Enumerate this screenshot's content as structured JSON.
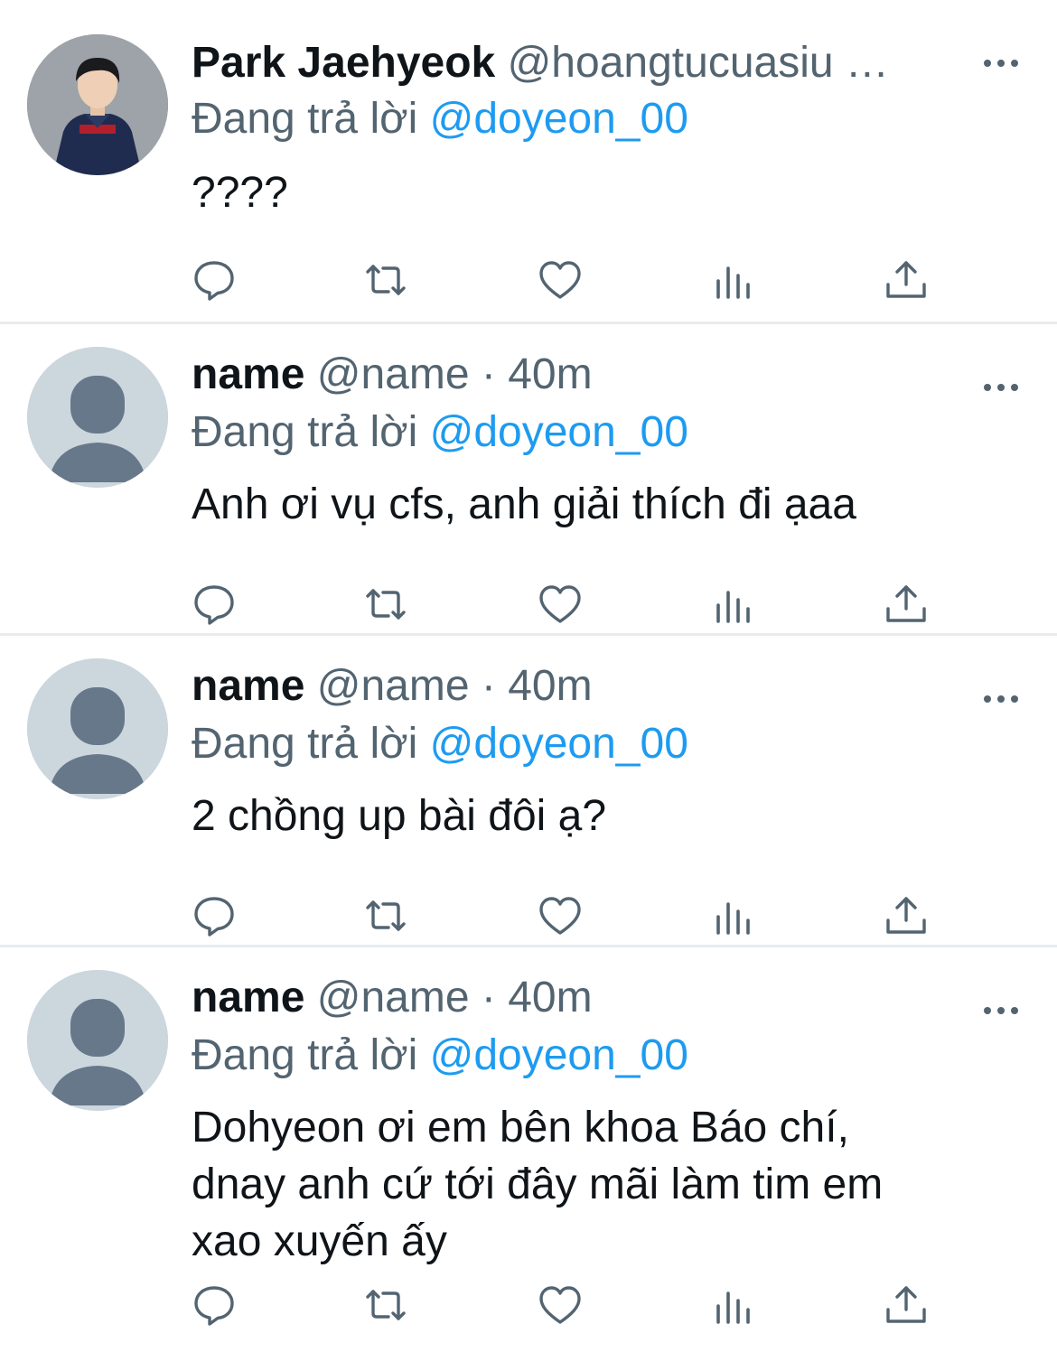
{
  "colors": {
    "text_primary": "#0f1419",
    "text_secondary": "#536471",
    "link_blue": "#1d9bf0",
    "divider": "#e9ecef",
    "default_avatar_bg": "#ccd6dd",
    "default_avatar_fg": "#66788a"
  },
  "reply_prefix": "Đang trả lời",
  "tweets": [
    {
      "display_name": "Park Jaehyeok",
      "handle": "@hoangtucuasiu",
      "meta": " …",
      "reply_to": "@doyeon_00",
      "text": "????",
      "avatar": "profile-photo"
    },
    {
      "display_name": "name",
      "handle": "@name",
      "meta": " · 40m",
      "reply_to": "@doyeon_00",
      "text": "Anh ơi vụ cfs, anh giải thích đi ạaa",
      "avatar": "default-avatar"
    },
    {
      "display_name": "name",
      "handle": "@name",
      "meta": " · 40m",
      "reply_to": "@doyeon_00",
      "text": "2 chồng up bài đôi ạ?",
      "avatar": "default-avatar"
    },
    {
      "display_name": "name",
      "handle": "@name",
      "meta": " · 40m",
      "reply_to": "@doyeon_00",
      "text": "Dohyeon ơi em bên khoa Báo chí,\ndnay anh cứ tới đây mãi làm tim em\nxao xuyến ấy",
      "avatar": "default-avatar"
    }
  ],
  "action_icons": [
    "reply-icon",
    "retweet-icon",
    "like-icon",
    "views-icon",
    "share-icon"
  ]
}
